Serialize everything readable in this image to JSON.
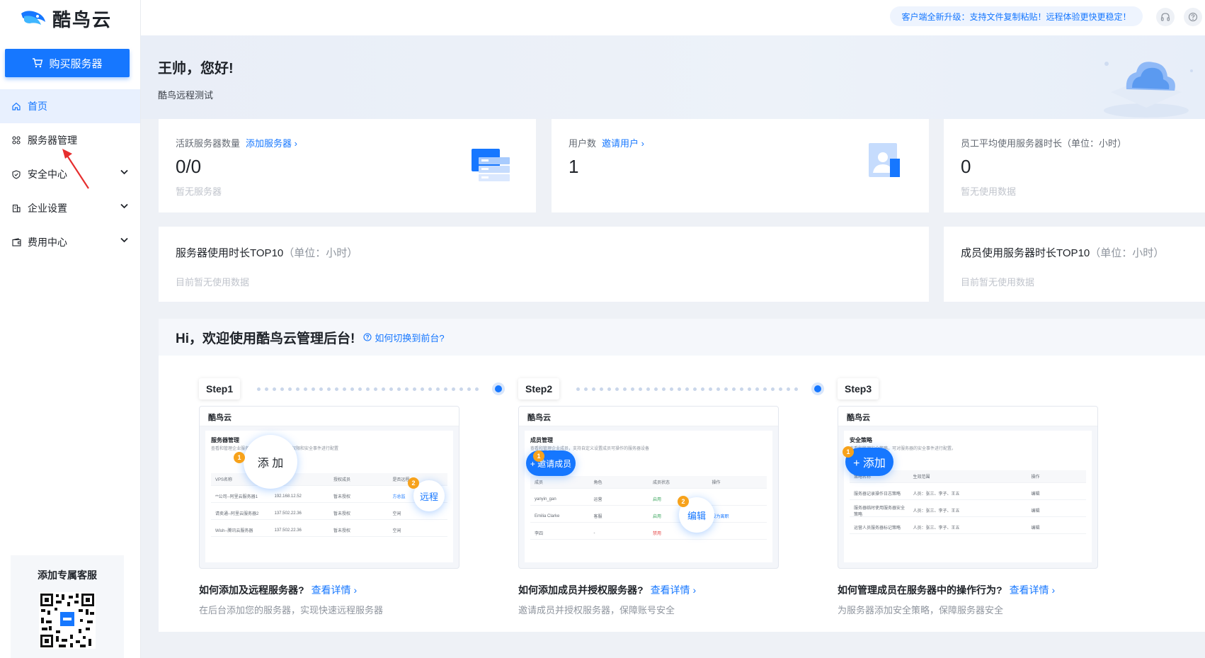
{
  "brand": {
    "name": "酷鸟云"
  },
  "sidebar": {
    "buy_button": "购买服务器",
    "items": [
      {
        "label": "首页",
        "icon": "home-icon",
        "active": true
      },
      {
        "label": "服务器管理",
        "icon": "apps-icon",
        "active": false
      },
      {
        "label": "安全中心",
        "icon": "shield-icon",
        "active": false,
        "expandable": true
      },
      {
        "label": "企业设置",
        "icon": "building-icon",
        "active": false,
        "expandable": true
      },
      {
        "label": "费用中心",
        "icon": "wallet-icon",
        "active": false,
        "expandable": true
      }
    ],
    "customer_service": "添加专属客服"
  },
  "topbar": {
    "notice": "客户端全新升级：支持文件复制粘贴！远程体验更快更稳定！",
    "icons": [
      "headset-icon",
      "help-icon"
    ]
  },
  "hero": {
    "greeting": "王帅，您好!",
    "subtitle": "酷鸟远程测试"
  },
  "stats": {
    "servers": {
      "label": "活跃服务器数量",
      "link": "添加服务器",
      "value": "0/0",
      "empty": "暂无服务器"
    },
    "users": {
      "label": "用户数",
      "link": "邀请用户",
      "value": "1"
    },
    "avg_time": {
      "label": "员工平均使用服务器时长（单位：小时）",
      "value": "0",
      "empty": "暂无使用数据"
    }
  },
  "top10": {
    "server": {
      "title": "服务器使用时长TOP10",
      "unit": "（单位：小时）",
      "empty": "目前暂无使用数据"
    },
    "member": {
      "title": "成员使用服务器时长TOP10",
      "unit": "（单位：小时）",
      "empty": "目前暂无使用数据"
    }
  },
  "guide": {
    "title": "Hi，欢迎使用酷鸟云管理后台!",
    "help": "如何切换到前台?",
    "steps": [
      {
        "tag": "Step1",
        "shot_logo": "酷鸟云",
        "shot_heading": "服务器管理",
        "shot_desc": "查看和管理企业服务器，设置服务器的使用权限和安全事件进行配置",
        "rows": [
          [
            "VPS名称",
            "IP地址",
            "授权成员",
            "是否远程"
          ],
          [
            "**公司--阿里云服务器1",
            "192.168.12.52",
            "暂未授权",
            "方总监"
          ],
          [
            "请卖通--阿里云服务器2",
            "137.502.22.36",
            "暂未授权",
            "空闲"
          ],
          [
            "Wish--腾讯云服务器",
            "137.502.22.36",
            "暂未授权",
            "空闲"
          ]
        ],
        "bubble1": "添 加",
        "bubble2": "远程",
        "question": "如何添加及远程服务器?",
        "link": "查看详情",
        "desc": "在后台添加您的服务器，实现快速远程服务器"
      },
      {
        "tag": "Step2",
        "shot_logo": "酷鸟云",
        "shot_heading": "成员管理",
        "shot_desc": "查看和管理企业成员，支持自定义设置成员可操作的服务器设备",
        "rows": [
          [
            "成员",
            "角色",
            "成员状态",
            "操作"
          ],
          [
            "yanyin_gan",
            "运营",
            "启用",
            ""
          ],
          [
            "Emilia Clarke",
            "客服",
            "启用",
            "设为离职"
          ],
          [
            "李四",
            "-",
            "禁用",
            ""
          ]
        ],
        "bubble1": "+ 邀请成员",
        "bubble2": "编辑",
        "question": "如何添加成员并授权服务器?",
        "link": "查看详情",
        "desc": "邀请成员并授权服务器，保障账号安全"
      },
      {
        "tag": "Step3",
        "shot_logo": "酷鸟云",
        "shot_heading": "安全策略",
        "shot_desc": "查看和管理安全策略，可对服务器的安全事件进行配置。",
        "rows": [
          [
            "策略名称",
            "生效范围",
            "",
            "操作"
          ],
          [
            "服务器记录操作日志策略",
            "人员：张三、李子、王五",
            "",
            "编辑"
          ],
          [
            "服务器临时使用服务器安全策略",
            "人员：张三、李子、王五",
            "",
            "编辑"
          ],
          [
            "运营人员服务器标记策略",
            "人员：张三、李子、王五",
            "",
            "编辑"
          ]
        ],
        "bubble1": "+ 添加",
        "question": "如何管理成员在服务器中的操作行为?",
        "link": "查看详情",
        "desc": "为服务器添加安全策略，保障服务器安全"
      }
    ]
  },
  "colors": {
    "primary": "#1677ff",
    "accent_orange": "#f7a21b",
    "sidebar_active_bg": "#e8f0fe"
  }
}
